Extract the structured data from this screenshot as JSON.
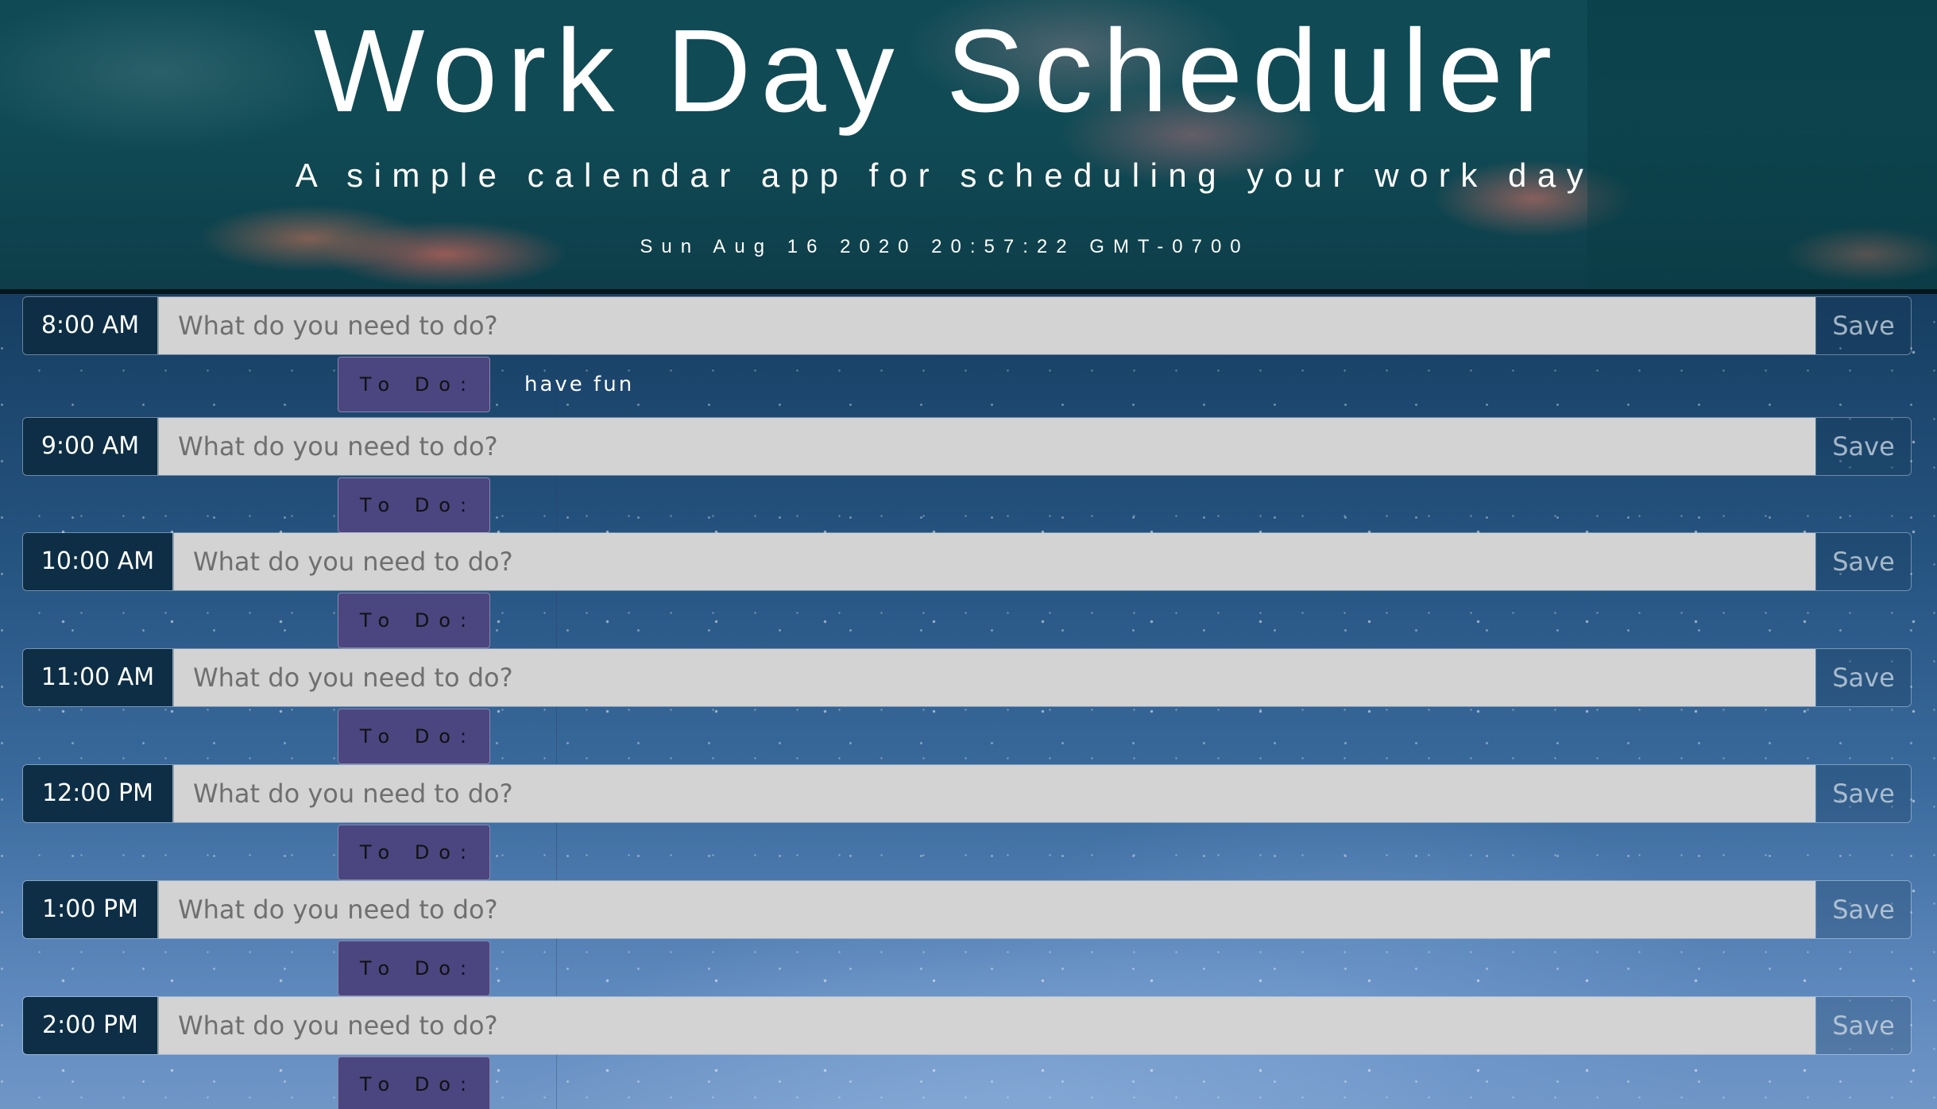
{
  "header": {
    "title": "Work Day Scheduler",
    "subtitle": "A simple calendar app for scheduling your work day",
    "current_day": "Sun Aug 16 2020 20:57:22 GMT-0700"
  },
  "rows": [
    {
      "hour": "8:00 AM",
      "placeholder": "What do you need to do?",
      "value": "",
      "save_label": "Save",
      "todo_label": "To Do:",
      "todo_text": "have fun"
    },
    {
      "hour": "9:00 AM",
      "placeholder": "What do you need to do?",
      "value": "",
      "save_label": "Save",
      "todo_label": "To Do:",
      "todo_text": ""
    },
    {
      "hour": "10:00 AM",
      "placeholder": "What do you need to do?",
      "value": "",
      "save_label": "Save",
      "todo_label": "To Do:",
      "todo_text": ""
    },
    {
      "hour": "11:00 AM",
      "placeholder": "What do you need to do?",
      "value": "",
      "save_label": "Save",
      "todo_label": "To Do:",
      "todo_text": ""
    },
    {
      "hour": "12:00 PM",
      "placeholder": "What do you need to do?",
      "value": "",
      "save_label": "Save",
      "todo_label": "To Do:",
      "todo_text": ""
    },
    {
      "hour": "1:00 PM",
      "placeholder": "What do you need to do?",
      "value": "",
      "save_label": "Save",
      "todo_label": "To Do:",
      "todo_text": ""
    },
    {
      "hour": "2:00 PM",
      "placeholder": "What do you need to do?",
      "value": "",
      "save_label": "Save",
      "todo_label": "To Do:",
      "todo_text": ""
    }
  ]
}
